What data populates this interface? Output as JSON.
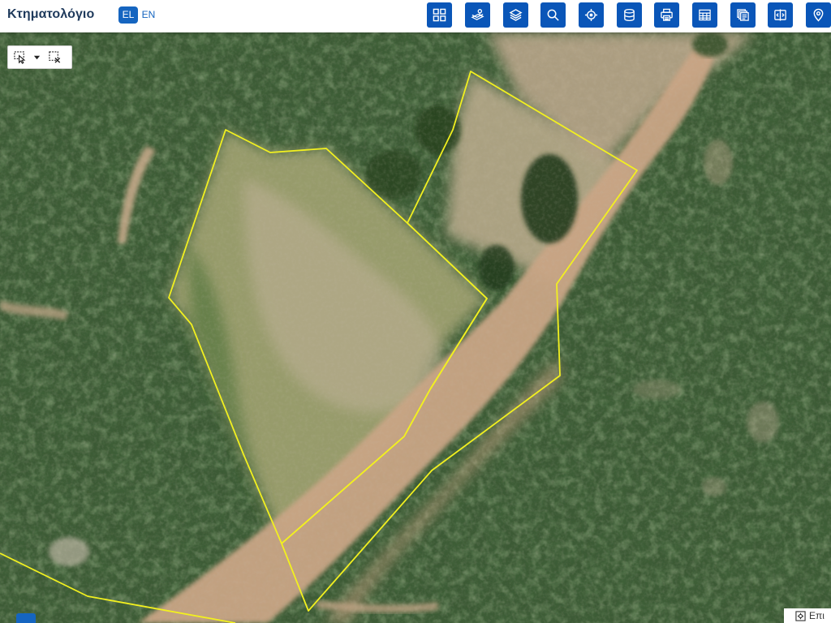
{
  "header": {
    "app_title": "Κτηματολόγιο",
    "languages": [
      {
        "code": "EL",
        "active": true
      },
      {
        "code": "EN",
        "active": false
      }
    ],
    "tools": [
      {
        "icon": "grid-icon"
      },
      {
        "icon": "map-parcels-icon"
      },
      {
        "icon": "layers-icon"
      },
      {
        "icon": "search-map-icon"
      },
      {
        "icon": "locate-icon"
      },
      {
        "icon": "database-icon"
      },
      {
        "icon": "print-icon"
      },
      {
        "icon": "table-icon"
      },
      {
        "icon": "stacked-docs-icon"
      },
      {
        "icon": "compare-icon"
      },
      {
        "icon": "map-pin-icon"
      }
    ]
  },
  "colors": {
    "toolbar_blue": "#0a56b8",
    "accent_blue": "#1565c0",
    "parcel_outline": "#f2f01f",
    "title_color": "#1f3a5c"
  },
  "selection_tools": {
    "items": [
      {
        "icon": "pointer-select-icon"
      },
      {
        "icon": "dropdown-caret-icon"
      },
      {
        "icon": "clear-selection-icon"
      }
    ]
  },
  "bottom_panel": {
    "icon": "zoom-extent-icon",
    "label": "Επι"
  }
}
